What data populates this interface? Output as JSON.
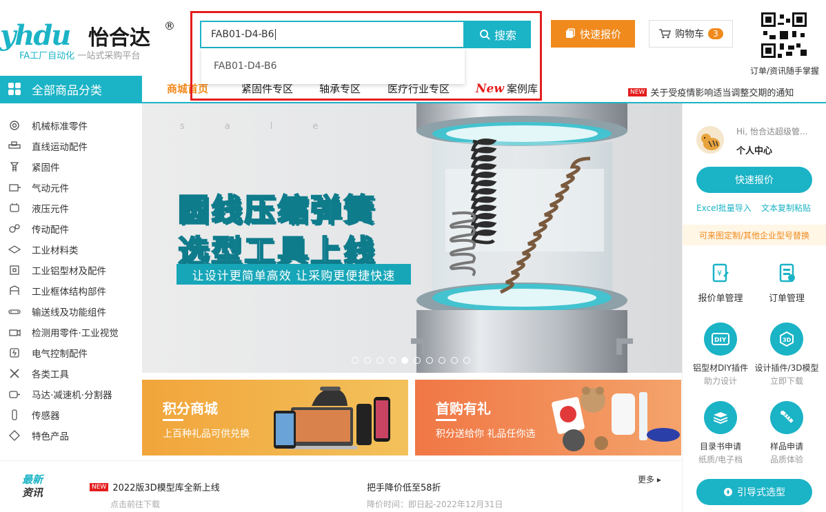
{
  "brand": {
    "logo_latin": "yhdu",
    "name_cn": "怡合达",
    "registered": "®",
    "tagline_fa": "FA工厂自动化",
    "tagline_rest": " 一站式采购平台"
  },
  "search": {
    "value": "FAB01-D4-B6",
    "button_label": "搜索",
    "suggestions": [
      "FAB01-D4-B6"
    ]
  },
  "header": {
    "quick_quote_label": "快速报价",
    "cart_label": "购物车",
    "cart_count": "3",
    "qr_caption": "订单/资讯随手掌握"
  },
  "nav": {
    "all_categories": "全部商品分类",
    "items": [
      "商城首页",
      "紧固件专区",
      "轴承专区",
      "医疗行业专区"
    ],
    "case_new": "New",
    "case_label": "案例库",
    "notice_tag": "NEW",
    "notice_text": "关于受疫情影响适当调整交期的通知"
  },
  "sidebar": {
    "items": [
      {
        "label": "机械标准零件",
        "icon": "gear-icon"
      },
      {
        "label": "直线运动配件",
        "icon": "linear-rail-icon"
      },
      {
        "label": "紧固件",
        "icon": "screw-icon"
      },
      {
        "label": "气动元件",
        "icon": "cylinder-icon"
      },
      {
        "label": "液压元件",
        "icon": "hydraulic-icon"
      },
      {
        "label": "传动配件",
        "icon": "transmission-icon"
      },
      {
        "label": "工业材料类",
        "icon": "material-icon"
      },
      {
        "label": "工业铝型材及配件",
        "icon": "aluminum-profile-icon"
      },
      {
        "label": "工业框体结构部件",
        "icon": "frame-icon"
      },
      {
        "label": "输送线及功能组件",
        "icon": "conveyor-icon"
      },
      {
        "label": "检测用零件·工业视觉",
        "icon": "camera-icon"
      },
      {
        "label": "电气控制配件",
        "icon": "electrical-icon"
      },
      {
        "label": "各类工具",
        "icon": "tools-icon"
      },
      {
        "label": "马达·减速机·分割器",
        "icon": "motor-icon"
      },
      {
        "label": "传感器",
        "icon": "sensor-icon"
      },
      {
        "label": "特色产品",
        "icon": "diamond-icon"
      }
    ]
  },
  "banner": {
    "sale_text": "sale",
    "title_line1": "圆线压缩弹簧",
    "title_line2": "选型工具上线",
    "subtitle": "让设计更简单高效 让采购更便捷快速",
    "slide_count": 10,
    "active_slide": 5
  },
  "promos": [
    {
      "title": "积分商城",
      "subtitle": "上百种礼品可供兑换"
    },
    {
      "title": "首购有礼",
      "subtitle": "积分送给你 礼品任你选"
    }
  ],
  "news": {
    "tag_line1": "最新",
    "tag_line2": "资讯",
    "more_label": "更多",
    "items": [
      {
        "tag": "NEW",
        "title": "2022版3D模型库全新上线",
        "sub": "点击前往下载"
      },
      {
        "title": "把手降价低至58折",
        "sub": "降价时间：即日起-2022年12月31日"
      }
    ]
  },
  "user_panel": {
    "greeting": "Hi, 怡合达超级管...",
    "center_label": "个人中心",
    "quick_quote_label": "快速报价",
    "excel_import": "Excel批量导入",
    "text_paste": "文本复制粘贴",
    "custom_banner": "可来图定制/其他企业型号替换",
    "tools": [
      {
        "label": "报价单管理",
        "icon": "quote-doc-icon"
      },
      {
        "label": "订单管理",
        "icon": "order-icon"
      }
    ],
    "services": [
      {
        "label": "铝型材DIY插件",
        "sub": "助力设计",
        "icon": "diy-icon"
      },
      {
        "label": "设计插件/3D模型",
        "sub": "立即下载",
        "icon": "3d-model-icon"
      },
      {
        "label": "目录书申请",
        "sub": "纸质/电子档",
        "icon": "catalog-icon"
      },
      {
        "label": "样品申请",
        "sub": "品质体验",
        "icon": "sample-icon"
      }
    ],
    "guide_label": "引导式选型"
  },
  "colors": {
    "teal": "#1bb3c6",
    "orange": "#f08a1d",
    "red_highlight": "#e51d1d"
  }
}
